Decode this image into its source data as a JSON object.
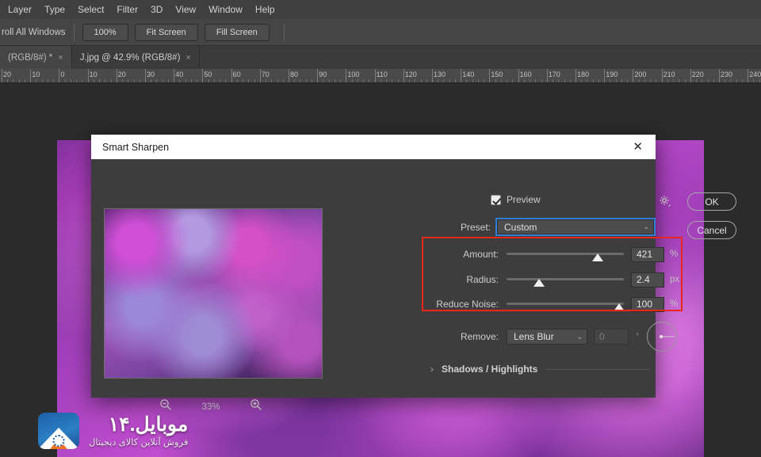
{
  "menubar": {
    "items": [
      {
        "label": "Layer"
      },
      {
        "label": "Type"
      },
      {
        "label": "Select"
      },
      {
        "label": "Filter"
      },
      {
        "label": "3D"
      },
      {
        "label": "View"
      },
      {
        "label": "Window"
      },
      {
        "label": "Help"
      }
    ]
  },
  "options_bar": {
    "scroll_all_windows_label": "roll All Windows",
    "buttons": [
      {
        "label": "100%",
        "name": "zoom-100-button"
      },
      {
        "label": "Fit Screen",
        "name": "fit-screen-button"
      },
      {
        "label": "Fill Screen",
        "name": "fill-screen-button"
      }
    ]
  },
  "tabs": [
    {
      "label": "(RGB/8#) *",
      "close": "×",
      "active": false
    },
    {
      "label": "J.jpg @ 42.9% (RGB/8#)",
      "close": "×",
      "active": true
    }
  ],
  "ruler": {
    "labels": [
      "20",
      "10",
      "0",
      "10",
      "20",
      "30",
      "40",
      "50",
      "60",
      "70",
      "80",
      "90",
      "100",
      "110",
      "120",
      "130",
      "140",
      "150",
      "160",
      "170",
      "180",
      "190",
      "200",
      "210",
      "220",
      "230",
      "240"
    ],
    "unit": "mm"
  },
  "watermark": {
    "title": "موبایل.۱۴",
    "subtitle": "فروش آنلاین کالای دیجیتال"
  },
  "dialog": {
    "title": "Smart Sharpen",
    "close_glyph": "✕",
    "preview": {
      "label": "Preview",
      "checked": true
    },
    "gear_tooltip": "Preset options",
    "buttons": {
      "ok": "OK",
      "cancel": "Cancel"
    },
    "preset": {
      "label": "Preset:",
      "value": "Custom",
      "chevron": "⌄",
      "focused": true
    },
    "sliders": [
      {
        "name": "amount",
        "label": "Amount:",
        "value": "421",
        "unit": "%",
        "percent": 78
      },
      {
        "name": "radius",
        "label": "Radius:",
        "value": "2.4",
        "unit": "px",
        "percent": 28
      },
      {
        "name": "reduce-noise",
        "label": "Reduce Noise:",
        "value": "100",
        "unit": "%",
        "percent": 96
      }
    ],
    "remove": {
      "label": "Remove:",
      "value": "Lens Blur",
      "chevron": "⌄",
      "angle_value": "0",
      "angle_unit": "°"
    },
    "shadows_highlights": {
      "label": "Shadows / Highlights",
      "chevron": "›",
      "expanded": false
    },
    "zoom_controls": {
      "zoom_out": "zoom-out-icon",
      "zoom_in": "zoom-in-icon",
      "percent": "33%"
    },
    "highlight_color": "#e8261a"
  },
  "theme": {
    "app_background": "#3a3a3a",
    "panel_background": "#3d3d3d",
    "titlebar_background": "#ffffff",
    "accent_focus": "#2f7fd4",
    "text_primary": "#d4d4d4"
  }
}
